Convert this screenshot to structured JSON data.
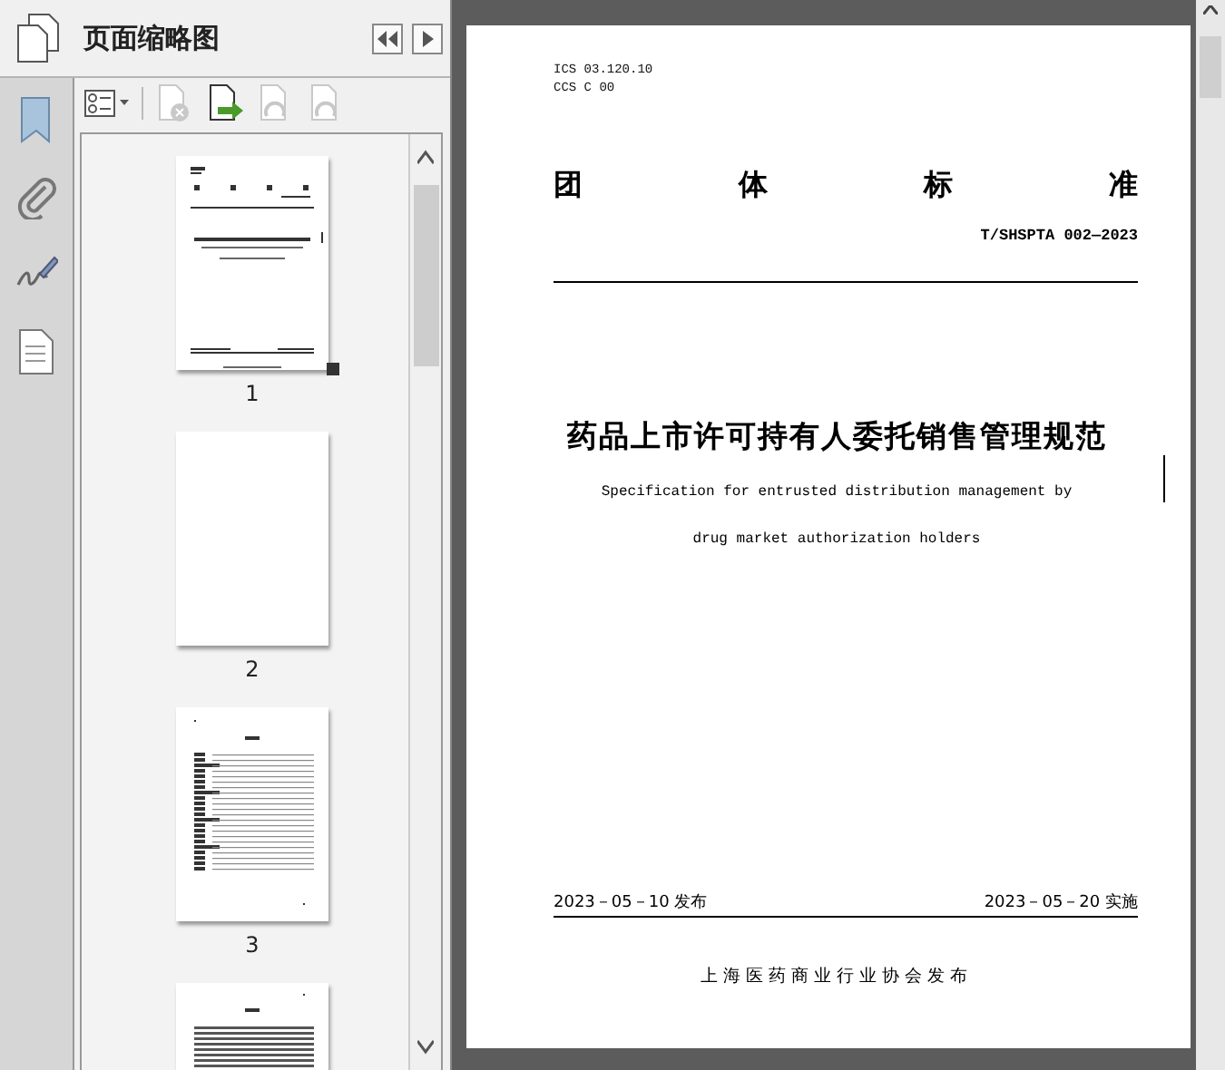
{
  "panel": {
    "title": "页面缩略图",
    "tools": [
      {
        "kind": "options",
        "disabled": false
      },
      {
        "kind": "delete",
        "disabled": true
      },
      {
        "kind": "insert",
        "disabled": false
      },
      {
        "kind": "undo",
        "disabled": true
      },
      {
        "kind": "redo",
        "disabled": true
      }
    ],
    "thumbnails": [
      {
        "kind": "cover",
        "label": "1",
        "selected": true
      },
      {
        "kind": "blank",
        "label": "2",
        "selected": false
      },
      {
        "kind": "toc",
        "label": "3",
        "selected": false
      },
      {
        "kind": "text",
        "selected": false
      }
    ]
  },
  "document": {
    "codes": [
      "ICS 03.120.10",
      "CCS C 00"
    ],
    "heading": [
      "团",
      "体",
      "标",
      "准"
    ],
    "standard_number": "T/SHSPTA 002—2023",
    "title": "药品上市许可持有人委托销售管理规范",
    "subtitle_lines": [
      "Specification for entrusted distribution management by",
      "drug market authorization holders"
    ],
    "release_date": "2023－05－10 发布",
    "implementation_date": "2023－05－20 实施",
    "publisher": "上海医药商业行业协会发布"
  }
}
